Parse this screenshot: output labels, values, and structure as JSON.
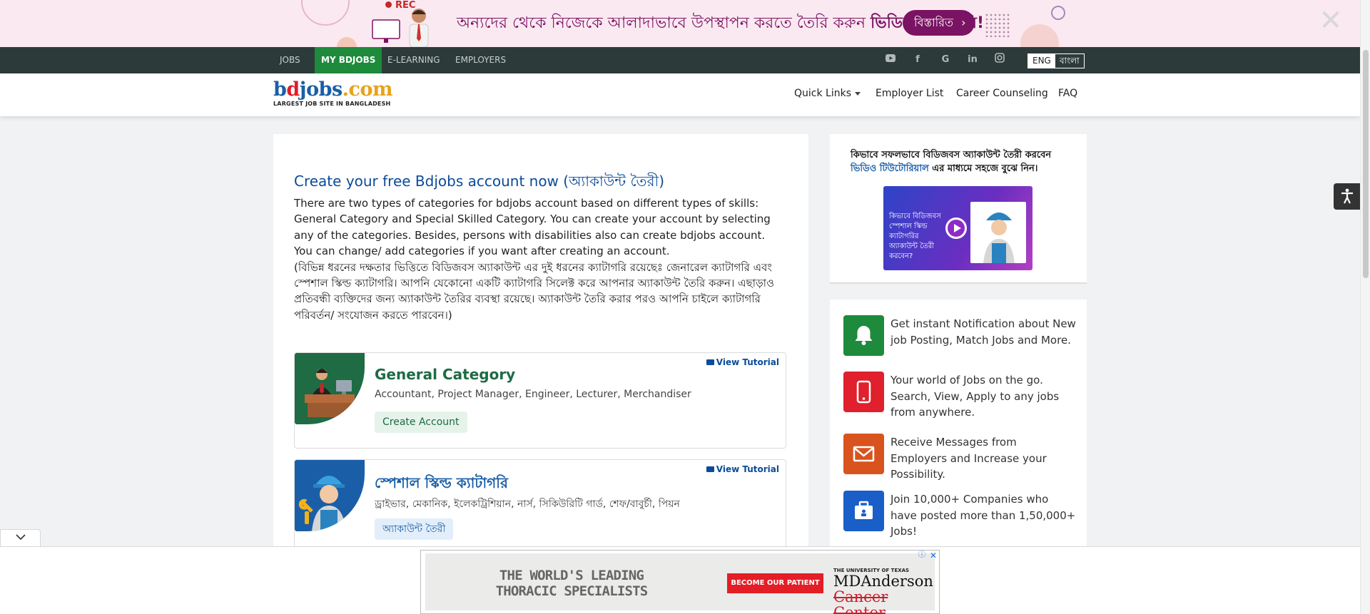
{
  "banner": {
    "rec": "REC",
    "text_normal": "অন্যদের থেকে নিজেকে আলাদাভাবে উপস্থাপন করতে তৈরি করুন",
    "text_bold": "ভিডিও রিজিউমি!",
    "button": "বিস্তারিত",
    "close": "✕"
  },
  "topnav": {
    "items": [
      "JOBS",
      "MY BDJOBS",
      "E-LEARNING",
      "EMPLOYERS"
    ],
    "lang_en": "ENG",
    "lang_bn": "বাংলা"
  },
  "header": {
    "logo_b": "b",
    "logo_d": "d",
    "logo_j": "j",
    "logo_obs": "obs",
    "logo_com": ".com",
    "logo_tagline": "LARGEST JOB SITE IN BANGLADESH",
    "links": [
      "Quick Links",
      "Employer List",
      "Career Counseling",
      "FAQ"
    ]
  },
  "main": {
    "title": "Create your free Bdjobs account now (অ্যাকাউন্ট তৈরী)",
    "desc_en": "There are two types of categories for bdjobs account based on different types of skills: General Category and Special Skilled Category. You can create your account by selecting any of the categories. Besides, persons with disabilities also can create bdjobs account. You can change/ add categories if you want after creating an account.",
    "desc_bn": "(বিভিন্ন ধরনের দক্ষতার ভিত্তিতে বিডিজবস অ্যাকাউন্ট এর দুই ধরনের ক্যাটাগরি রয়েছেঃ জেনারেল ক্যাটাগরি এবং স্পেশাল স্কিল্ড ক্যাটাগরি। আপনি যেকোনো একটি ক্যাটাগরি সিলেক্ট করে আপনার অ্যাকাউন্ট তৈরি করুন। এছাড়াও প্রতিবন্ধী ব্যক্তিদের জন্য অ্যাকাউন্ট তৈরির ব্যবস্থা রয়েছে। অ্যাকাউন্ট তৈরি করার পরও আপনি চাইলে ক্যাটাগরি পরিবর্তন/ সংযোজন করতে পারবেন।)",
    "categories": [
      {
        "title": "General Category",
        "subtitle": "Accountant, Project Manager, Engineer, Lecturer, Merchandiser",
        "button": "Create Account",
        "tutorial": "View Tutorial"
      },
      {
        "title": "স্পেশাল স্কিল্ড ক্যাটাগরি",
        "subtitle": "ড্রাইভার, মেকানিক, ইলেকট্রিশিয়ান, নার্স, সিকিউরিটি গার্ড, শেফ/বাবুর্চী, পিয়ন",
        "button": "অ্যাকাউন্ট তৈরী",
        "tutorial": "View Tutorial"
      }
    ]
  },
  "sidebar": {
    "tutorial_line1": "কিভাবে সফলভাবে বিডিজবস অ্যাকাউন্ট তৈরী করবেন",
    "tutorial_link": "ভিডিও টিউটোরিয়াল",
    "tutorial_line2": " এর মাধ্যমে সহজে বুঝে নিন।",
    "video_text": "কিভাবে বিডিজবস স্পেশাল স্কিল্ড ক্যাটাগরির অ্যাকাউন্ট তৈরী করবেন?",
    "features": [
      {
        "text": "Get instant Notification about New job Posting, Match Jobs and More.",
        "icon": "bell-icon",
        "color": "#1e8a3b"
      },
      {
        "text": "Your world of Jobs on the go. Search, View, Apply to any jobs from anywhere.",
        "icon": "mobile-icon",
        "color": "#e0202c"
      },
      {
        "text": "Receive Messages from Employers and Increase your Possibility.",
        "icon": "envelope-icon",
        "color": "#d9531e"
      },
      {
        "text": "Join 10,000+ Companies who have posted more than 1,50,000+ Jobs!",
        "icon": "briefcase-icon",
        "color": "#1a5ec8"
      }
    ]
  },
  "ad": {
    "headline": "THE WORLD'S LEADING THORACIC SPECIALISTS",
    "cta": "BECOME OUR PATIENT",
    "brand_top": "THE UNIVERSITY OF TEXAS",
    "brand_line1": "MDAnderson",
    "brand_line2": "Cancer Center",
    "close": "✕",
    "info": "ⓘ"
  },
  "colors": {
    "brand_green": "#1e8a3b",
    "brand_blue": "#0b4b9a",
    "banner_purple": "#7a1363"
  }
}
